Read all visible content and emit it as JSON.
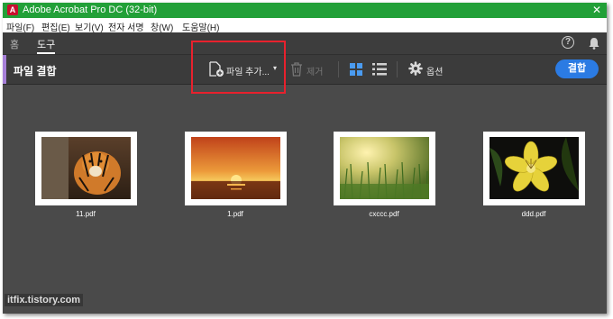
{
  "window": {
    "title": "Adobe Acrobat Pro DC (32-bit)",
    "close_glyph": "✕",
    "icon_letter": "A"
  },
  "menu": [
    "파일(F)",
    "편집(E)",
    "보기(V)",
    "전자 서명",
    "창(W)",
    "도움말(H)"
  ],
  "tabs": {
    "home": "홈",
    "tools": "도구"
  },
  "header_icons": {
    "help": "?"
  },
  "toolbar": {
    "title": "파일 결합",
    "add_files": "파일 추가...",
    "add_caret": "▾",
    "remove": "제거",
    "options": "옵션",
    "combine": "결합"
  },
  "files": [
    {
      "name": "11.pdf",
      "image": "tiger-photo"
    },
    {
      "name": "1.pdf",
      "image": "sunset-photo"
    },
    {
      "name": "cxccc.pdf",
      "image": "grass-field-photo"
    },
    {
      "name": "ddd.pdf",
      "image": "yellow-lily-photo"
    }
  ],
  "watermark": "itfix.tistory.com",
  "colors": {
    "titlebar": "#22a038",
    "accent": "#a67fd8",
    "combine_button": "#2b7be3",
    "highlight": "#e8212d",
    "workspace": "#4a4a4a"
  }
}
